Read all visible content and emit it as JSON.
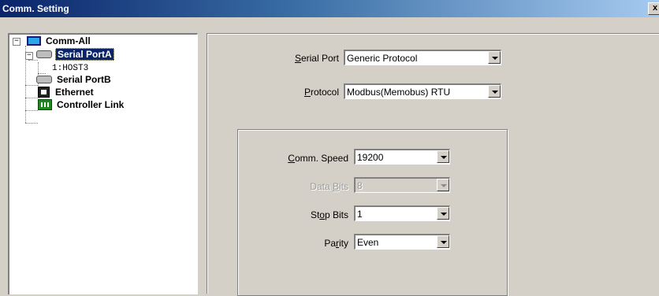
{
  "window": {
    "title": "Comm. Setting",
    "close_glyph": "x"
  },
  "tree": {
    "root": {
      "label": "Comm-All",
      "expander": "−",
      "icon": "monitor-icon"
    },
    "nodes": [
      {
        "label": "Serial PortA",
        "expander": "−",
        "icon": "serial-port-icon",
        "selected": true
      },
      {
        "label": "1:HOST3",
        "icon": "none"
      },
      {
        "label": "Serial PortB",
        "icon": "serial-port-icon"
      },
      {
        "label": "Ethernet",
        "icon": "ethernet-icon"
      },
      {
        "label": "Controller Link",
        "icon": "controller-link-icon"
      }
    ]
  },
  "settings": {
    "serial_port": {
      "label_pre": "",
      "label_u": "S",
      "label_post": "erial Port",
      "value": "Generic Protocol"
    },
    "protocol": {
      "label_pre": "",
      "label_u": "P",
      "label_post": "rotocol",
      "value": "Modbus(Memobus) RTU"
    }
  },
  "comm": {
    "speed": {
      "label_pre": "",
      "label_u": "C",
      "label_post": "omm. Speed",
      "value": "19200"
    },
    "data_bits": {
      "label_pre": "Data ",
      "label_u": "B",
      "label_post": "its",
      "value": "8",
      "disabled": true
    },
    "stop_bits": {
      "label_pre": "St",
      "label_u": "o",
      "label_post": "p Bits",
      "value": "1"
    },
    "parity": {
      "label_pre": "Pa",
      "label_u": "r",
      "label_post": "ity",
      "value": "Even"
    }
  },
  "colors": {
    "titlebar_start": "#0a246a",
    "titlebar_end": "#a6caf0",
    "face": "#d4d0c8",
    "selection": "#0a246a"
  }
}
